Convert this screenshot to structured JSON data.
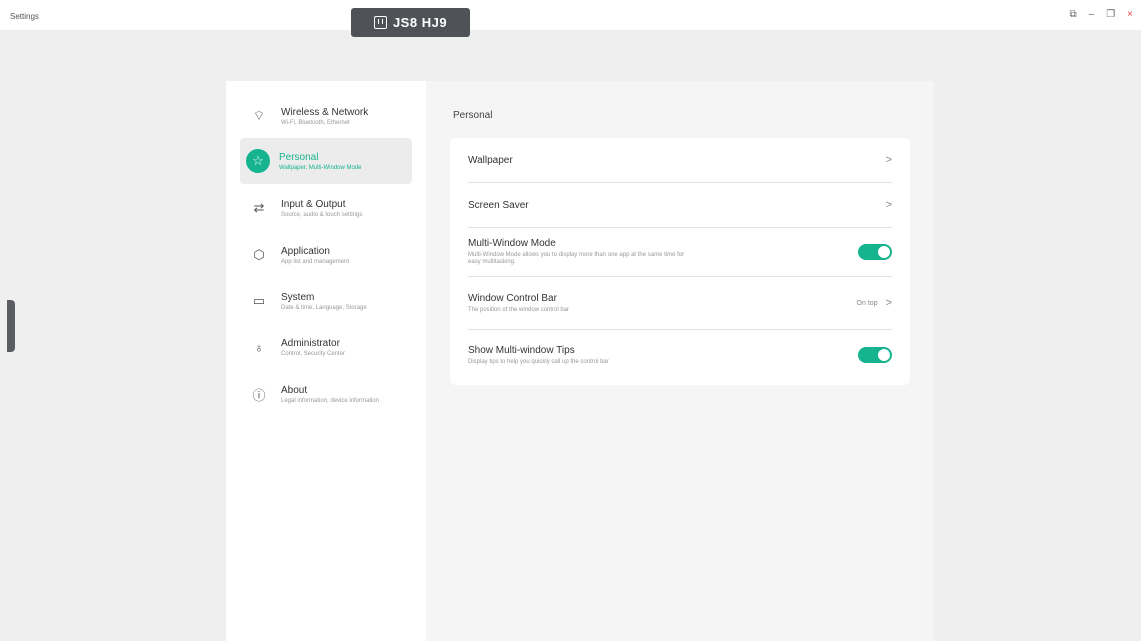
{
  "window": {
    "title": "Settings",
    "badge": "JS8 HJ9",
    "controls": [
      "⧉",
      "–",
      "❐",
      "×"
    ]
  },
  "sidebar": {
    "items": [
      {
        "label": "Wireless & Network",
        "desc": "Wi-Fi, Bluetooth, Ethernet",
        "icon": "wifi-icon",
        "glyph": "⌔"
      },
      {
        "label": "Personal",
        "desc": "Wallpaper, Multi-Window Mode",
        "icon": "star-icon",
        "glyph": "☆"
      },
      {
        "label": "Input & Output",
        "desc": "Source, audio & touch settings",
        "icon": "arrows-icon",
        "glyph": "⇄"
      },
      {
        "label": "Application",
        "desc": "App list and management",
        "icon": "cube-icon",
        "glyph": "⬡"
      },
      {
        "label": "System",
        "desc": "Date & time, Language, Storage",
        "icon": "display-icon",
        "glyph": "▭"
      },
      {
        "label": "Administrator",
        "desc": "Control, Security Center",
        "icon": "user-icon",
        "glyph": "♁"
      },
      {
        "label": "About",
        "desc": "Legal information, device information",
        "icon": "info-icon",
        "glyph": "ⓘ"
      }
    ],
    "active_index": 1
  },
  "main": {
    "title": "Personal",
    "rows": [
      {
        "label": "Wallpaper",
        "desc": "",
        "control": "chevron"
      },
      {
        "label": "Screen Saver",
        "desc": "",
        "control": "chevron"
      },
      {
        "label": "Multi-Window Mode",
        "desc": "Multi-Window Mode allows you to display more than one app at the same time for easy multitasking.",
        "control": "toggle",
        "on": true
      },
      {
        "label": "Window Control Bar",
        "desc": "The position of the window control bar",
        "control": "value",
        "value": "On top"
      },
      {
        "label": "Show Multi-window Tips",
        "desc": "Display tips to help you quickly call up the control bar",
        "control": "toggle",
        "on": true
      }
    ]
  },
  "colors": {
    "accent": "#16b38f",
    "background": "#efefef",
    "close": "#e0443e"
  }
}
